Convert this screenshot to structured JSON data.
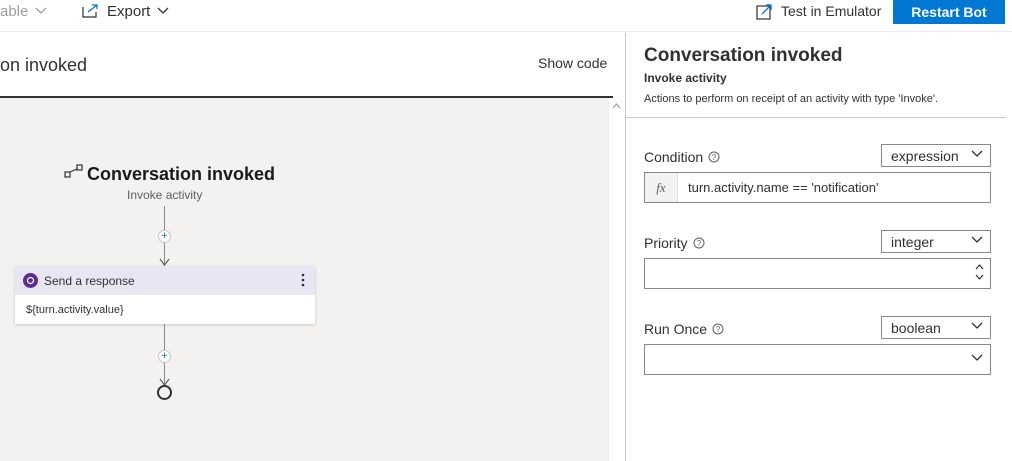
{
  "toolbar": {
    "disabled_label": "able",
    "export_label": "Export",
    "emulator_label": "Test in Emulator",
    "restart_label": "Restart Bot"
  },
  "editor": {
    "title": "on invoked",
    "show_code": "Show code"
  },
  "canvas": {
    "trigger_title": "Conversation invoked",
    "trigger_subtitle": "Invoke activity",
    "action": {
      "title": "Send a response",
      "body": "${turn.activity.value}"
    }
  },
  "properties": {
    "title": "Conversation invoked",
    "subtitle": "Invoke activity",
    "description": "Actions to perform on receipt of an activity with type 'Invoke'.",
    "fields": [
      {
        "label": "Condition",
        "type": "expression",
        "value": "turn.activity.name == 'notification'"
      },
      {
        "label": "Priority",
        "type": "integer",
        "value": ""
      },
      {
        "label": "Run Once",
        "type": "boolean",
        "value": ""
      }
    ]
  },
  "colors": {
    "accent": "#0078d4",
    "canvas_bg": "#f3f2f1",
    "card_header": "#e8e6f3",
    "action_badge": "#5c2d91"
  }
}
